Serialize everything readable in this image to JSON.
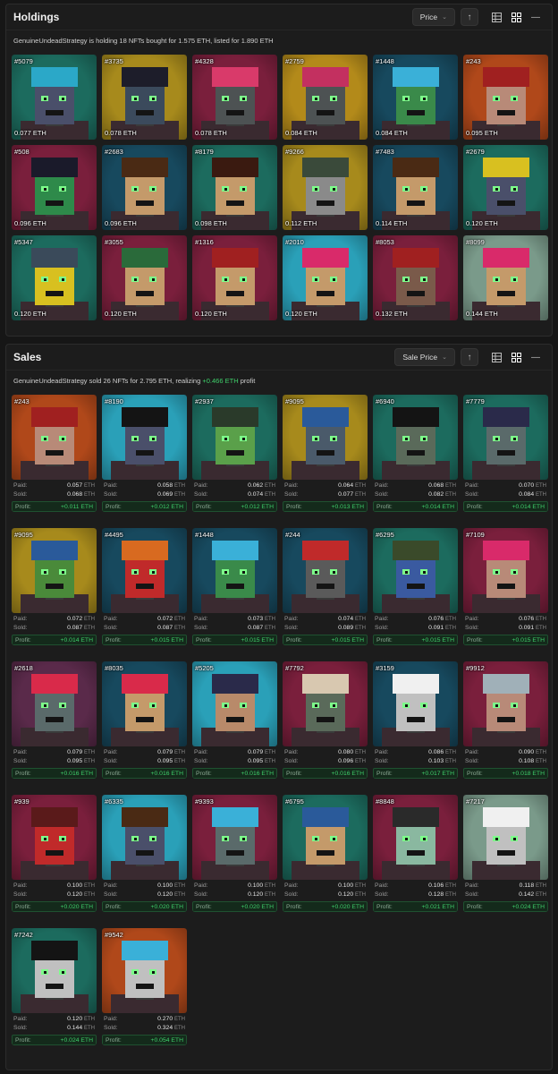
{
  "holdings": {
    "title": "Holdings",
    "sort_label": "Price",
    "summary": "GenuineUndeadStrategy is holding 18 NFTs bought for 1.575 ETH, listed for 1.890 ETH",
    "items": [
      {
        "id": "#5079",
        "price": "0.077 ETH",
        "bg": "#1c6b5e",
        "face": "#4a4f6a",
        "hat": "#2ba8c8"
      },
      {
        "id": "#3735",
        "price": "0.078 ETH",
        "bg": "#a78a1c",
        "face": "#3b4a5c",
        "hat": "#1d1d2a"
      },
      {
        "id": "#4328",
        "price": "0.078 ETH",
        "bg": "#7a1f3c",
        "face": "#4d5253",
        "hat": "#d93a6a"
      },
      {
        "id": "#2759",
        "price": "0.084 ETH",
        "bg": "#b38a1a",
        "face": "#4d5253",
        "hat": "#c33060"
      },
      {
        "id": "#1448",
        "price": "0.084 ETH",
        "bg": "#17495e",
        "face": "#3a8a4a",
        "hat": "#3ab0d8"
      },
      {
        "id": "#243",
        "price": "0.095 ETH",
        "bg": "#b0481a",
        "face": "#b88a78",
        "hat": "#a02020"
      },
      {
        "id": "#508",
        "price": "0.096 ETH",
        "bg": "#7a1f3c",
        "face": "#2e8a4a",
        "hat": "#1a1a2a"
      },
      {
        "id": "#2683",
        "price": "0.096 ETH",
        "bg": "#17495e",
        "face": "#c49a6a",
        "hat": "#4a2a14"
      },
      {
        "id": "#8179",
        "price": "0.098 ETH",
        "bg": "#1c6b5e",
        "face": "#c49a6a",
        "hat": "#3a1a10"
      },
      {
        "id": "#9266",
        "price": "0.112 ETH",
        "bg": "#a78a1c",
        "face": "#8a8a8a",
        "hat": "#3a4a3a"
      },
      {
        "id": "#7483",
        "price": "0.114 ETH",
        "bg": "#17495e",
        "face": "#c49a6a",
        "hat": "#4a2a14"
      },
      {
        "id": "#2679",
        "price": "0.120 ETH",
        "bg": "#1c6b5e",
        "face": "#4a4f6a",
        "hat": "#d8c020"
      },
      {
        "id": "#5347",
        "price": "0.120 ETH",
        "bg": "#1c6b5e",
        "face": "#d8c020",
        "hat": "#3a4a5a"
      },
      {
        "id": "#3055",
        "price": "0.120 ETH",
        "bg": "#7a1f3c",
        "face": "#c49a6a",
        "hat": "#2a6a3a"
      },
      {
        "id": "#1316",
        "price": "0.120 ETH",
        "bg": "#7a1f3c",
        "face": "#c49a6a",
        "hat": "#a02020"
      },
      {
        "id": "#2010",
        "price": "0.120 ETH",
        "bg": "#2aa0b8",
        "face": "#c49a6a",
        "hat": "#d92a6a"
      },
      {
        "id": "#8053",
        "price": "0.132 ETH",
        "bg": "#7a1f3c",
        "face": "#7a5a4a",
        "hat": "#a02020"
      },
      {
        "id": "#8099",
        "price": "0.144 ETH",
        "bg": "#7a9a8a",
        "face": "#c49a6a",
        "hat": "#d92a6a"
      }
    ]
  },
  "sales": {
    "title": "Sales",
    "sort_label": "Sale Price",
    "summary_prefix": "GenuineUndeadStrategy sold 26 NFTs for 2.795 ETH, realizing",
    "summary_profit": "+0.466 ETH",
    "summary_suffix": "profit",
    "paid_label": "Paid:",
    "sold_label": "Sold:",
    "profit_label": "Profit:",
    "unit": "ETH",
    "items": [
      {
        "id": "#243",
        "paid": "0.057",
        "sold": "0.068",
        "profit": "+0.011 ETH",
        "bg": "#b0481a",
        "face": "#b88a78",
        "hat": "#a02020"
      },
      {
        "id": "#8190",
        "paid": "0.058",
        "sold": "0.069",
        "profit": "+0.012 ETH",
        "bg": "#2aa0b8",
        "face": "#4a4f6a",
        "hat": "#141414"
      },
      {
        "id": "#2937",
        "paid": "0.062",
        "sold": "0.074",
        "profit": "+0.012 ETH",
        "bg": "#1c6b5e",
        "face": "#5aa04a",
        "hat": "#2a3a2a"
      },
      {
        "id": "#9095",
        "paid": "0.064",
        "sold": "0.077",
        "profit": "+0.013 ETH",
        "bg": "#a78a1c",
        "face": "#4a5a6a",
        "hat": "#2a5a9a"
      },
      {
        "id": "#6940",
        "paid": "0.068",
        "sold": "0.082",
        "profit": "+0.014 ETH",
        "bg": "#1c6b5e",
        "face": "#5a6a5a",
        "hat": "#141414"
      },
      {
        "id": "#7779",
        "paid": "0.070",
        "sold": "0.084",
        "profit": "+0.014 ETH",
        "bg": "#1c6b5e",
        "face": "#5a6a6a",
        "hat": "#2a2a4a"
      },
      {
        "id": "#9095",
        "paid": "0.072",
        "sold": "0.087",
        "profit": "+0.014 ETH",
        "bg": "#a78a1c",
        "face": "#4a8a3a",
        "hat": "#2a5a9a"
      },
      {
        "id": "#4495",
        "paid": "0.072",
        "sold": "0.087",
        "profit": "+0.015 ETH",
        "bg": "#17495e",
        "face": "#c02a2a",
        "hat": "#d86a20"
      },
      {
        "id": "#1448",
        "paid": "0.073",
        "sold": "0.087",
        "profit": "+0.015 ETH",
        "bg": "#17495e",
        "face": "#3a8a4a",
        "hat": "#3ab0d8"
      },
      {
        "id": "#244",
        "paid": "0.074",
        "sold": "0.089",
        "profit": "+0.015 ETH",
        "bg": "#17495e",
        "face": "#5a5a5a",
        "hat": "#c02a2a"
      },
      {
        "id": "#6295",
        "paid": "0.076",
        "sold": "0.091",
        "profit": "+0.015 ETH",
        "bg": "#1c6b5e",
        "face": "#3a5aa0",
        "hat": "#3a4a2a"
      },
      {
        "id": "#7109",
        "paid": "0.076",
        "sold": "0.091",
        "profit": "+0.015 ETH",
        "bg": "#7a1f3c",
        "face": "#b88a78",
        "hat": "#d92a6a"
      },
      {
        "id": "#2618",
        "paid": "0.079",
        "sold": "0.095",
        "profit": "+0.016 ETH",
        "bg": "#5a2a4a",
        "face": "#5a6a6a",
        "hat": "#d92a4a"
      },
      {
        "id": "#8035",
        "paid": "0.079",
        "sold": "0.095",
        "profit": "+0.016 ETH",
        "bg": "#17495e",
        "face": "#c49a6a",
        "hat": "#d92a4a"
      },
      {
        "id": "#5205",
        "paid": "0.079",
        "sold": "0.095",
        "profit": "+0.016 ETH",
        "bg": "#2aa0b8",
        "face": "#b88a6a",
        "hat": "#2a2a4a"
      },
      {
        "id": "#7792",
        "paid": "0.080",
        "sold": "0.096",
        "profit": "+0.016 ETH",
        "bg": "#7a1f3c",
        "face": "#5a6a5a",
        "hat": "#d8c8b0"
      },
      {
        "id": "#3159",
        "paid": "0.086",
        "sold": "0.103",
        "profit": "+0.017 ETH",
        "bg": "#17495e",
        "face": "#c0c0c0",
        "hat": "#f0f0f0"
      },
      {
        "id": "#9912",
        "paid": "0.090",
        "sold": "0.108",
        "profit": "+0.018 ETH",
        "bg": "#7a1f3c",
        "face": "#b88a78",
        "hat": "#a0b0b8"
      },
      {
        "id": "#939",
        "paid": "0.100",
        "sold": "0.120",
        "profit": "+0.020 ETH",
        "bg": "#7a1f3c",
        "face": "#c02a2a",
        "hat": "#5a1a1a"
      },
      {
        "id": "#6335",
        "paid": "0.100",
        "sold": "0.120",
        "profit": "+0.020 ETH",
        "bg": "#2aa0b8",
        "face": "#4a4f6a",
        "hat": "#4a2a14"
      },
      {
        "id": "#9393",
        "paid": "0.100",
        "sold": "0.120",
        "profit": "+0.020 ETH",
        "bg": "#7a1f3c",
        "face": "#5a6a6a",
        "hat": "#3ab0d8"
      },
      {
        "id": "#6795",
        "paid": "0.100",
        "sold": "0.120",
        "profit": "+0.020 ETH",
        "bg": "#1c6b5e",
        "face": "#c49a6a",
        "hat": "#2a5a9a"
      },
      {
        "id": "#8848",
        "paid": "0.106",
        "sold": "0.128",
        "profit": "+0.021 ETH",
        "bg": "#7a1f3c",
        "face": "#8ab8a0",
        "hat": "#2a2a2a"
      },
      {
        "id": "#7217",
        "paid": "0.118",
        "sold": "0.142",
        "profit": "+0.024 ETH",
        "bg": "#7a9a8a",
        "face": "#c0c0c0",
        "hat": "#f0f0f0"
      },
      {
        "id": "#7242",
        "paid": "0.120",
        "sold": "0.144",
        "profit": "+0.024 ETH",
        "bg": "#1c6b5e",
        "face": "#c0c0c0",
        "hat": "#141414"
      },
      {
        "id": "#9542",
        "paid": "0.270",
        "sold": "0.324",
        "profit": "+0.054 ETH",
        "bg": "#b0481a",
        "face": "#c0c0c0",
        "hat": "#3ab0d8"
      }
    ]
  }
}
